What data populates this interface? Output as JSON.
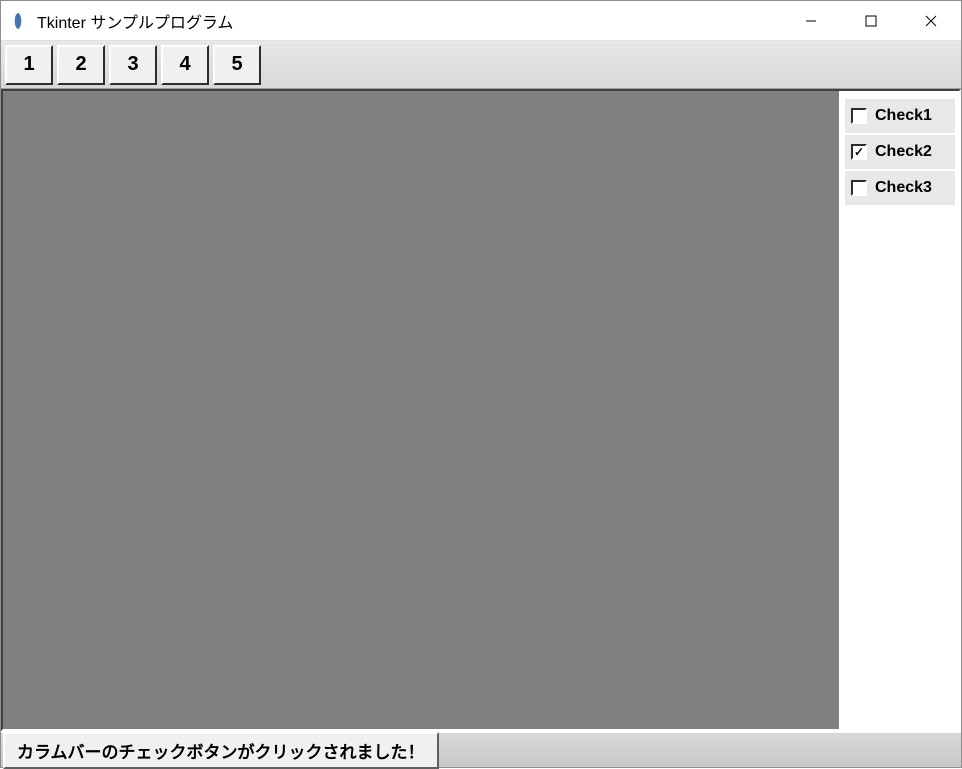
{
  "window": {
    "title": "Tkinter サンプルプログラム"
  },
  "toolbar": {
    "buttons": [
      {
        "label": "1"
      },
      {
        "label": "2"
      },
      {
        "label": "3"
      },
      {
        "label": "4"
      },
      {
        "label": "5"
      }
    ]
  },
  "sidebar": {
    "checks": [
      {
        "label": "Check1",
        "checked": false,
        "highlighted": true
      },
      {
        "label": "Check2",
        "checked": true,
        "highlighted": true
      },
      {
        "label": "Check3",
        "checked": false,
        "highlighted": true
      }
    ]
  },
  "statusbar": {
    "message": "カラムバーのチェックボタンがクリックされました！"
  }
}
